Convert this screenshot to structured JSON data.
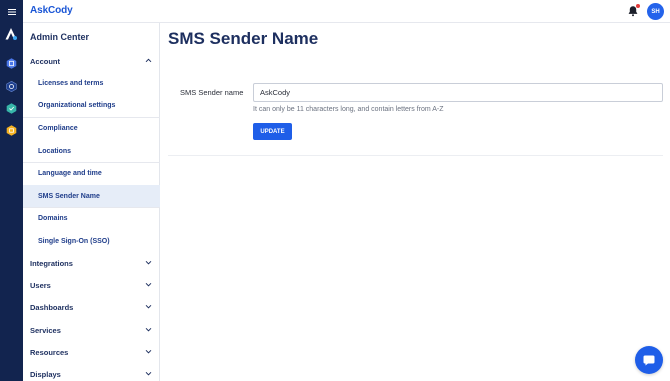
{
  "header": {
    "logo_text": "AskCody",
    "avatar_initials": "SH",
    "accent": "#1f5ee8"
  },
  "rail": {
    "icons": [
      "askcody-logo-icon",
      "rooms-icon",
      "catering-icon",
      "services-icon",
      "resources-icon"
    ]
  },
  "sidebar": {
    "title": "Admin Center",
    "sections": [
      {
        "label": "Account",
        "expanded": true,
        "items": [
          {
            "label": "Licenses and terms"
          },
          {
            "label": "Organizational settings"
          },
          {
            "label": "Compliance"
          },
          {
            "label": "Locations"
          },
          {
            "label": "Language and time"
          },
          {
            "label": "SMS Sender Name",
            "active": true
          },
          {
            "label": "Domains"
          },
          {
            "label": "Single Sign-On (SSO)"
          }
        ]
      },
      {
        "label": "Integrations",
        "expanded": false
      },
      {
        "label": "Users",
        "expanded": false
      },
      {
        "label": "Dashboards",
        "expanded": false
      },
      {
        "label": "Services",
        "expanded": false
      },
      {
        "label": "Resources",
        "expanded": false
      },
      {
        "label": "Displays",
        "expanded": false
      }
    ]
  },
  "main": {
    "title": "SMS Sender Name",
    "field_label": "SMS Sender name",
    "field_value": "AskCody",
    "hint": "It can only be 11 characters long, and contain letters from A-Z",
    "update_label": "UPDATE"
  }
}
